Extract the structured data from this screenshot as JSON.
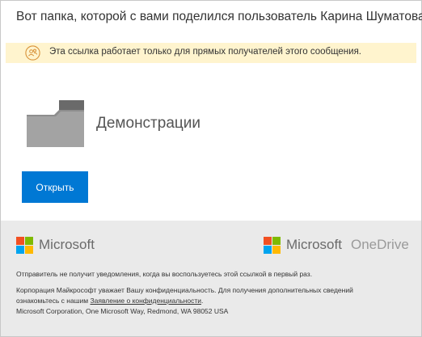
{
  "header": {
    "text": "Вот папка, которой с вами поделился пользователь Карина Шуматова."
  },
  "notice": {
    "icon": "people-icon",
    "text": "Эта ссылка работает только для прямых получателей этого сообщения."
  },
  "item": {
    "icon": "folder-icon",
    "name": "Демонстрации",
    "open_label": "Открыть"
  },
  "footer": {
    "logos": {
      "left": "Microsoft",
      "right_brand": "Microsoft",
      "right_product": "OneDrive"
    },
    "notification_text": "Отправитель не получит уведомления, когда вы воспользуетесь этой ссылкой в первый раз.",
    "privacy_line1": "Корпорация Майкрософт уважает Вашу конфиденциальность. Для получения дополнительных сведений",
    "privacy_line2_prefix": "ознакомьтесь с нашим ",
    "privacy_link": "Заявление о конфиденциальности",
    "privacy_line2_suffix": ".",
    "address": "Microsoft Corporation, One Microsoft Way, Redmond, WA 98052 USA"
  },
  "colors": {
    "accent": "#0078d4",
    "notice_bg": "#fff4ce",
    "footer_bg": "#eaeaea",
    "ms_red": "#f25022",
    "ms_green": "#7fba00",
    "ms_blue": "#00a4ef",
    "ms_yellow": "#ffb900",
    "icon_orange": "#d8923a"
  }
}
